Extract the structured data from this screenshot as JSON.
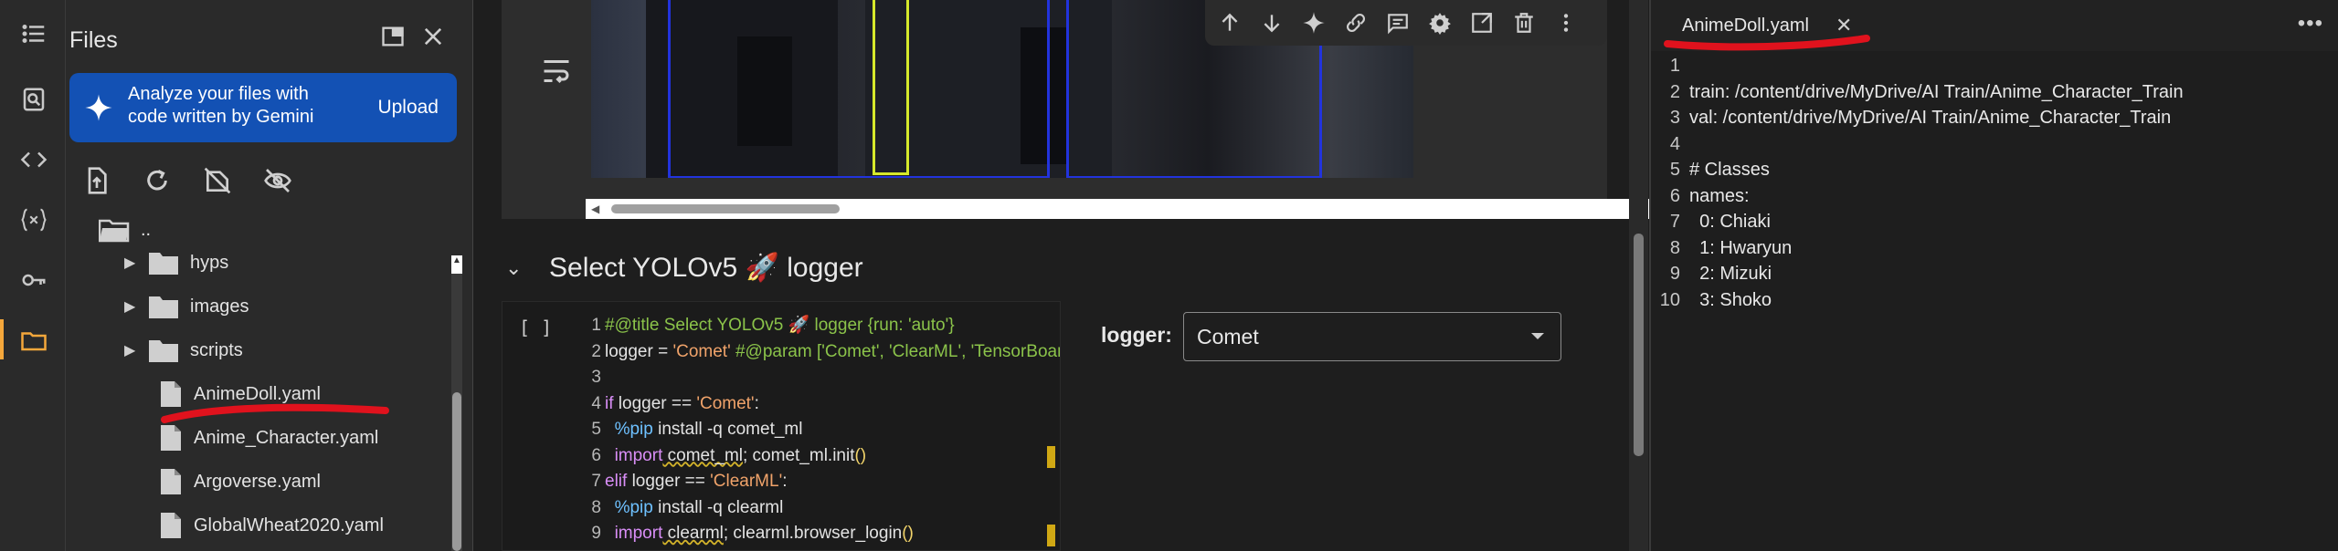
{
  "sidebar": {
    "active": "files"
  },
  "files": {
    "title": "Files",
    "gemini": {
      "text": "Analyze your files with code written by Gemini",
      "action": "Upload"
    },
    "parent_label": "..",
    "tree": [
      {
        "type": "folder",
        "name": "hyps"
      },
      {
        "type": "folder",
        "name": "images"
      },
      {
        "type": "folder",
        "name": "scripts"
      },
      {
        "type": "file",
        "name": "AnimeDoll.yaml"
      },
      {
        "type": "file",
        "name": "Anime_Character.yaml"
      },
      {
        "type": "file",
        "name": "Argoverse.yaml"
      },
      {
        "type": "file",
        "name": "GlobalWheat2020.yaml"
      }
    ]
  },
  "notebook": {
    "section_title": "Select YOLOv5 🚀 logger",
    "cell_bracket": "[ ]",
    "logger_label": "logger:",
    "logger_value": "Comet",
    "code": [
      {
        "n": "1",
        "parts": [
          {
            "c": "c-green",
            "t": "#@title Select YOLOv5 🚀 logger {run: 'auto'}"
          }
        ]
      },
      {
        "n": "2",
        "parts": [
          {
            "c": "c-white",
            "t": "logger = "
          },
          {
            "c": "c-orange",
            "t": "'Comet'"
          },
          {
            "c": "c-green",
            "t": " #@param ['Comet', 'ClearML', 'TensorBoard']"
          }
        ]
      },
      {
        "n": "3",
        "parts": [
          {
            "c": "c-white",
            "t": ""
          }
        ]
      },
      {
        "n": "4",
        "parts": [
          {
            "c": "c-kw",
            "t": "if"
          },
          {
            "c": "c-white",
            "t": " logger == "
          },
          {
            "c": "c-orange",
            "t": "'Comet'"
          },
          {
            "c": "c-white",
            "t": ":"
          }
        ]
      },
      {
        "n": "5",
        "parts": [
          {
            "c": "c-white",
            "t": "  "
          },
          {
            "c": "c-magic",
            "t": "%pip"
          },
          {
            "c": "c-white",
            "t": " install -q comet_ml"
          }
        ]
      },
      {
        "n": "6",
        "parts": [
          {
            "c": "c-white",
            "t": "  "
          },
          {
            "c": "c-kw",
            "t": "import"
          },
          {
            "c": "c-white squig",
            "t": " comet_ml"
          },
          {
            "c": "c-white",
            "t": "; comet_ml.init"
          },
          {
            "c": "c-yellow",
            "t": "()"
          }
        ]
      },
      {
        "n": "7",
        "parts": [
          {
            "c": "c-kw",
            "t": "elif"
          },
          {
            "c": "c-white",
            "t": " logger == "
          },
          {
            "c": "c-orange",
            "t": "'ClearML'"
          },
          {
            "c": "c-white",
            "t": ":"
          }
        ]
      },
      {
        "n": "8",
        "parts": [
          {
            "c": "c-white",
            "t": "  "
          },
          {
            "c": "c-magic",
            "t": "%pip"
          },
          {
            "c": "c-white",
            "t": " install -q clearml"
          }
        ]
      },
      {
        "n": "9",
        "parts": [
          {
            "c": "c-white",
            "t": "  "
          },
          {
            "c": "c-kw",
            "t": "import"
          },
          {
            "c": "c-white squig",
            "t": " clearml"
          },
          {
            "c": "c-white",
            "t": "; clearml.browser_login"
          },
          {
            "c": "c-yellow",
            "t": "()"
          }
        ]
      }
    ]
  },
  "editor": {
    "tab_name": "AnimeDoll.yaml",
    "lines": [
      {
        "n": "1",
        "t": ""
      },
      {
        "n": "2",
        "t": "train: /content/drive/MyDrive/AI Train/Anime_Character_Train"
      },
      {
        "n": "3",
        "t": "val: /content/drive/MyDrive/AI Train/Anime_Character_Train"
      },
      {
        "n": "4",
        "t": ""
      },
      {
        "n": "5",
        "t": "# Classes"
      },
      {
        "n": "6",
        "t": "names:"
      },
      {
        "n": "7",
        "t": "  0: Chiaki"
      },
      {
        "n": "8",
        "t": "  1: Hwaryun"
      },
      {
        "n": "9",
        "t": "  2: Mizuki"
      },
      {
        "n": "10",
        "t": "  3: Shoko"
      }
    ]
  }
}
